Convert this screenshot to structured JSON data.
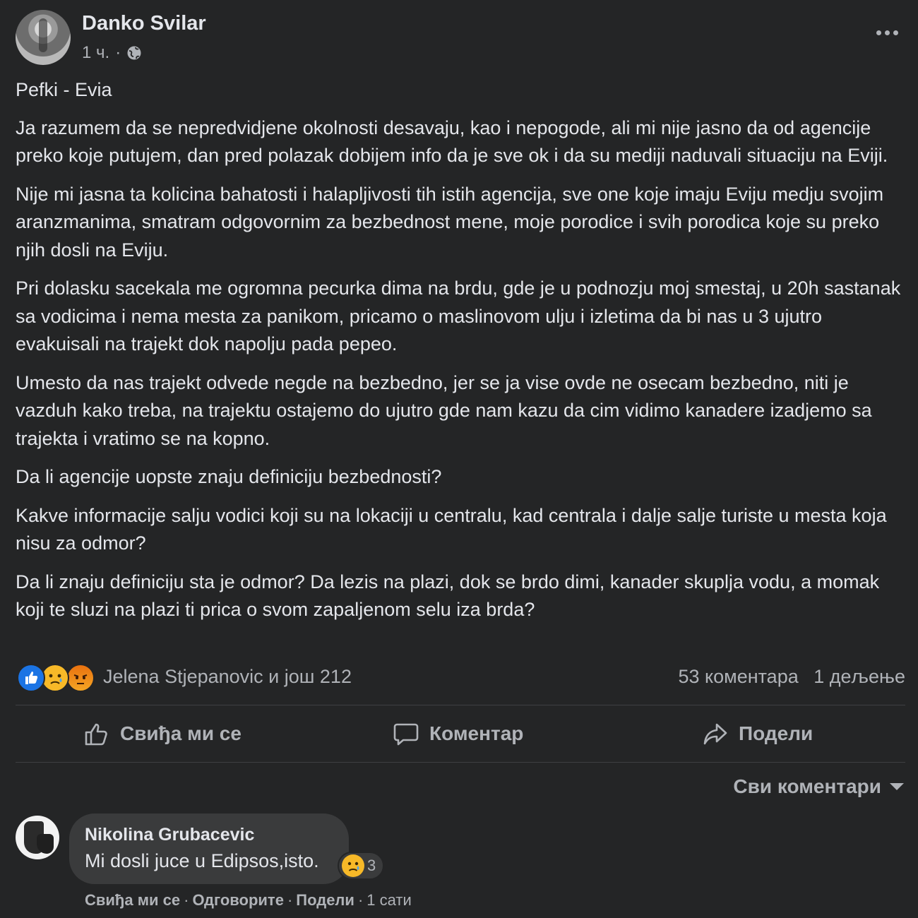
{
  "post": {
    "author": "Danko Svilar",
    "time": "1 ч.",
    "meta_separator": "·",
    "privacy_icon": "globe-icon",
    "paragraphs": [
      "Pefki - Evia",
      "Ja razumem da se nepredvidjene okolnosti desavaju, kao i nepogode, ali mi nije jasno da od agencije preko koje putujem, dan pred polazak dobijem info da je sve ok i da su mediji naduvali situaciju na Eviji.",
      "Nije mi jasna ta kolicina bahatosti i halapljivosti tih istih agencija, sve one koje imaju Eviju medju svojim aranzmanima, smatram odgovornim za bezbednost mene, moje porodice i svih porodica koje su preko njih dosli na Eviju.",
      "Pri dolasku sacekala me ogromna pecurka dima na brdu, gde je u podnozju moj smestaj, u 20h sastanak sa vodicima i nema mesta za panikom, pricamo o maslinovom ulju i izletima da bi nas u 3 ujutro evakuisali na trajekt dok napolju pada pepeo.",
      "Umesto da nas trajekt odvede negde na bezbedno, jer se ja vise ovde ne osecam bezbedno, niti je vazduh kako treba, na trajektu ostajemo do ujutro gde nam kazu da cim vidimo kanadere izadjemo sa trajekta i vratimo se na kopno.",
      "Da li agencije uopste znaju definiciju bezbednosti?",
      "Kakve informacije salju vodici koji su na lokaciji u centralu, kad centrala i dalje salje turiste u mesta koja nisu za odmor?",
      "Da li znaju definiciju sta je odmor? Da lezis na plazi, dok se brdo dimi, kanader skuplja vodu, a momak koji te sluzi na plazi ti prica o svom zapaljenom selu iza brda?"
    ]
  },
  "reactions": {
    "icons": [
      "like-reaction-icon",
      "sad-reaction-icon",
      "angry-reaction-icon"
    ],
    "summary": "Jelena Stjepanovic и још 212",
    "comments_count": "53 коментара",
    "shares_count": "1 дељење"
  },
  "actions": {
    "like": "Свиђа ми се",
    "comment": "Коментар",
    "share": "Подели"
  },
  "comments_filter": "Сви коментари",
  "comment": {
    "author": "Nikolina Grubacevic",
    "text": "Mi dosli juce u Edipsos,isto.",
    "reaction_icon": "sad-reaction-icon",
    "reaction_count": "3",
    "like": "Свиђа ми се",
    "reply": "Одговорите",
    "share": "Подели",
    "separator": "·",
    "time": "1 сати"
  },
  "colors": {
    "background": "#242526",
    "text_primary": "#e4e6eb",
    "text_secondary": "#b0b3b8",
    "bubble": "#3a3b3c",
    "like_blue": "#1b74e4",
    "reaction_yellow": "#f7b928"
  }
}
